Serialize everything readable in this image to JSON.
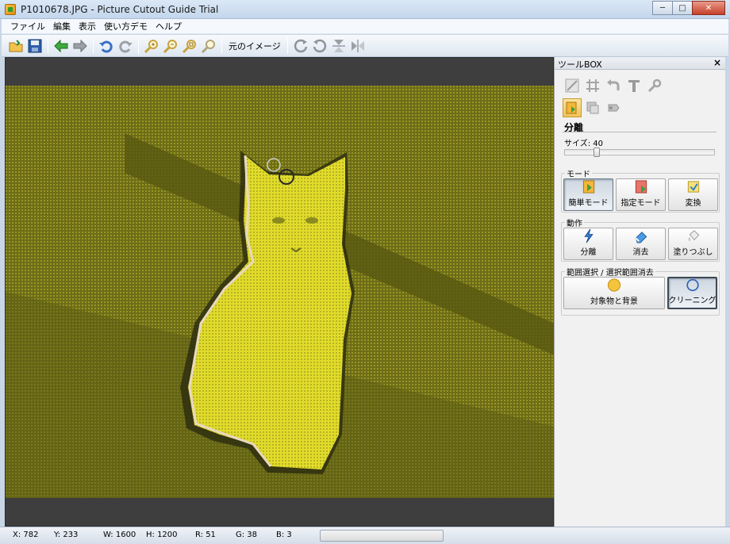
{
  "window": {
    "title": "P1010678.JPG - Picture Cutout Guide Trial",
    "minimize": "─",
    "maximize": "□",
    "close": "✕"
  },
  "menu": [
    "ファイル",
    "編集",
    "表示",
    "使い方デモ",
    "ヘルプ"
  ],
  "toolbar": {
    "original_image_label": "元のイメージ"
  },
  "toolbox": {
    "title": "ツールBOX",
    "close": "×",
    "section_title": "分離",
    "size_label": "サイズ: 40",
    "size_value": 40,
    "size_fraction": 0.2,
    "mode_group": {
      "label": "モード",
      "buttons": [
        "簡単モード",
        "指定モード",
        "変換"
      ],
      "selected": "簡単モード"
    },
    "action_group": {
      "label": "動作",
      "buttons": [
        "分離",
        "消去",
        "塗りつぶし"
      ]
    },
    "range_group": {
      "label": "範囲選択 / 選択範囲消去",
      "buttons": [
        "対象物と背景",
        "クリーニング"
      ],
      "selected": "クリーニング"
    }
  },
  "status": {
    "x": "X: 782",
    "y": "Y: 233",
    "w": "W: 1600",
    "h": "H: 1200",
    "r": "R: 51",
    "g": "G: 38",
    "b": "B: 3"
  },
  "colors": {
    "overlay": "#d7d321",
    "canvas_bg": "#3e3e3e"
  }
}
